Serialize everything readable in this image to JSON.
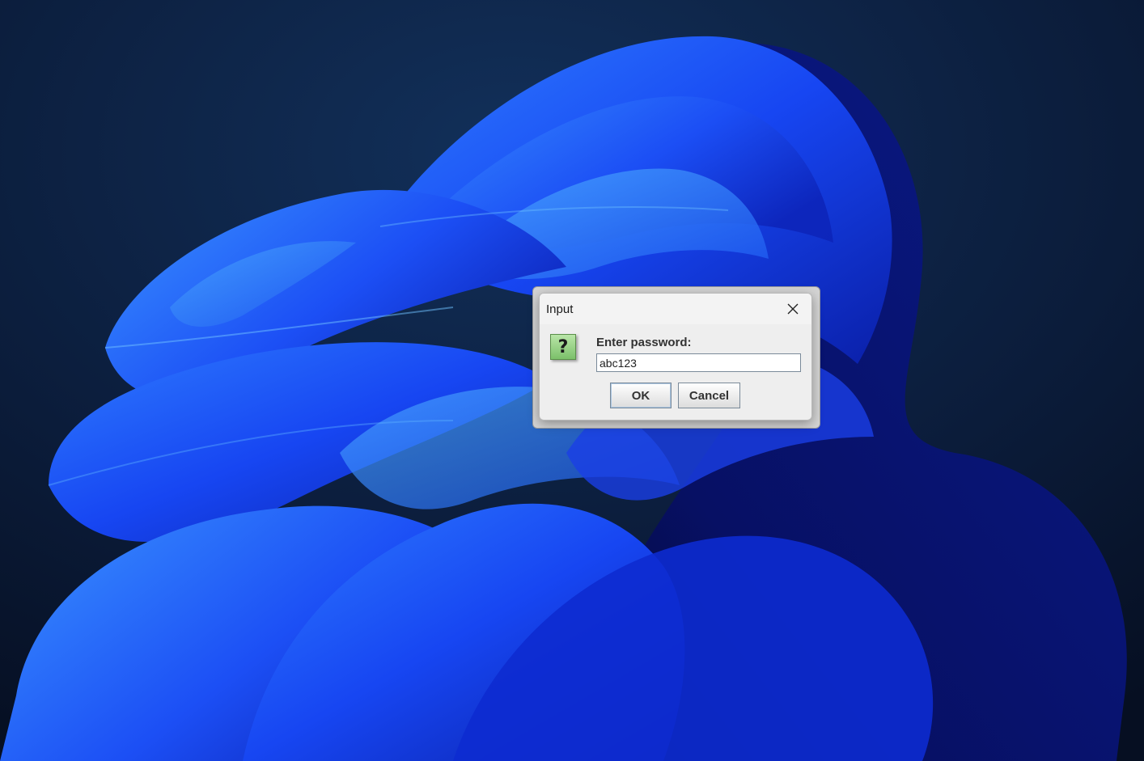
{
  "dialog": {
    "title": "Input",
    "close_icon": "close-icon",
    "message_icon": "question-icon",
    "prompt_label": "Enter password:",
    "input_value": "abc123",
    "ok_label": "OK",
    "cancel_label": "Cancel"
  },
  "colors": {
    "wallpaper_dark": "#0b1a36",
    "wallpaper_blue": "#1f4dff",
    "dialog_bg": "#eeeeee",
    "icon_green": "#8fd07a"
  }
}
